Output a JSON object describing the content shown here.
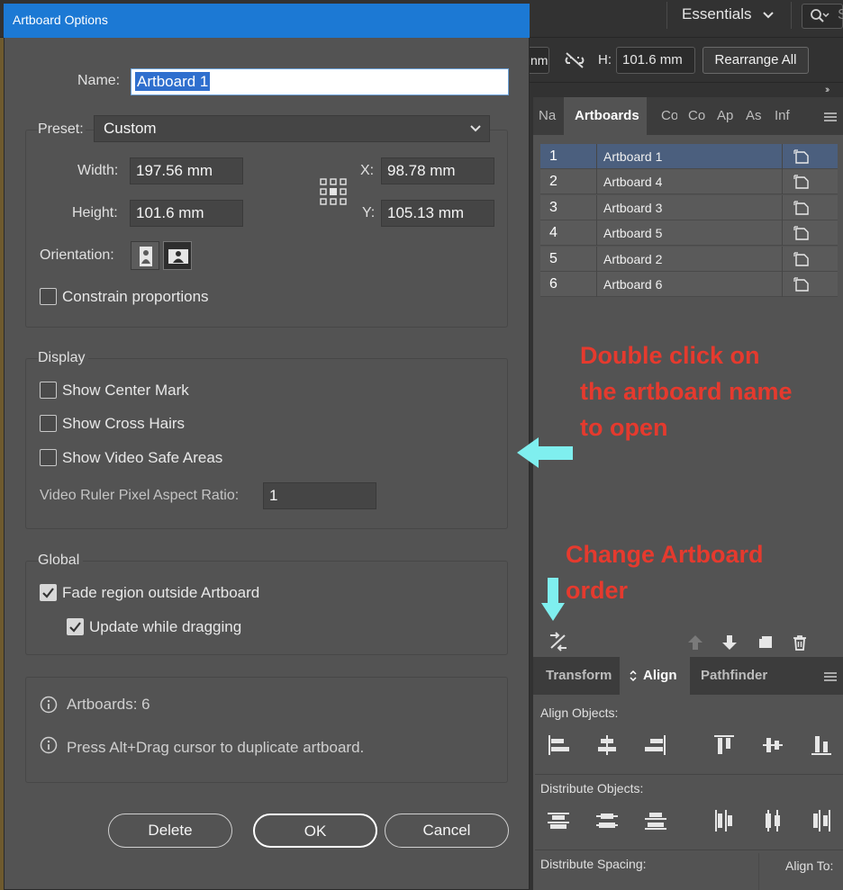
{
  "app": {
    "workspace_label": "Essentials",
    "search_partial": "S",
    "control_bar": {
      "width_partial": "nm",
      "height_label": "H:",
      "height_value": "101.6 mm",
      "rearrange_label": "Rearrange All",
      "collapse_glyph": "››"
    }
  },
  "artboards_panel": {
    "tabs": [
      {
        "label": "Na",
        "active": false
      },
      {
        "label": "Artboards",
        "active": true
      },
      {
        "label": "Co",
        "active": false
      },
      {
        "label": "Col",
        "active": false
      },
      {
        "label": "Ap",
        "active": false
      },
      {
        "label": "As",
        "active": false
      },
      {
        "label": "Inf",
        "active": false
      }
    ],
    "rows": [
      {
        "num": "1",
        "name": "Artboard 1",
        "selected": true
      },
      {
        "num": "2",
        "name": "Artboard 4",
        "selected": false
      },
      {
        "num": "3",
        "name": "Artboard 3",
        "selected": false
      },
      {
        "num": "4",
        "name": "Artboard 5",
        "selected": false
      },
      {
        "num": "5",
        "name": "Artboard 2",
        "selected": false
      },
      {
        "num": "6",
        "name": "Artboard 6",
        "selected": false
      }
    ],
    "footer_icons": [
      "rearrange-icon",
      "move-up-icon",
      "move-down-icon",
      "new-artboard-icon",
      "trash-icon"
    ]
  },
  "align_panel": {
    "tabs": [
      {
        "label": "Transform",
        "active": false
      },
      {
        "label": "Align",
        "active": true
      },
      {
        "label": "Pathfinder",
        "active": false
      }
    ],
    "align_objects_label": "Align Objects:",
    "distribute_objects_label": "Distribute Objects:",
    "distribute_spacing_label": "Distribute Spacing:",
    "align_to_label": "Align To:"
  },
  "dialog": {
    "title": "Artboard Options",
    "name_label": "Name:",
    "name_value": "Artboard 1",
    "preset_label": "Preset:",
    "preset_value": "Custom",
    "width_label": "Width:",
    "width_value": "197.56 mm",
    "height_label": "Height:",
    "height_value": "101.6 mm",
    "x_label": "X:",
    "x_value": "98.78 mm",
    "y_label": "Y:",
    "y_value": "105.13 mm",
    "orientation_label": "Orientation:",
    "constrain_label": "Constrain proportions",
    "constrain_checked": false,
    "display_heading": "Display",
    "show_center_mark": "Show Center Mark",
    "show_cross_hairs": "Show Cross Hairs",
    "show_video_safe": "Show Video Safe Areas",
    "video_ratio_label": "Video Ruler Pixel Aspect Ratio:",
    "video_ratio_value": "1",
    "global_heading": "Global",
    "fade_region": "Fade region outside Artboard",
    "fade_checked": true,
    "update_dragging": "Update while dragging",
    "update_checked": true,
    "artboards_info": "Artboards: 6",
    "tip_info": "Press Alt+Drag cursor to duplicate artboard.",
    "delete_label": "Delete",
    "ok_label": "OK",
    "cancel_label": "Cancel"
  },
  "annotations": {
    "double_click_lines": [
      "Double click on",
      "the artboard name",
      "to open"
    ],
    "change_order_lines": [
      "Change Artboard",
      "order"
    ],
    "annotation_color": "#e53a2e",
    "arrow_color": "#7fefef"
  }
}
